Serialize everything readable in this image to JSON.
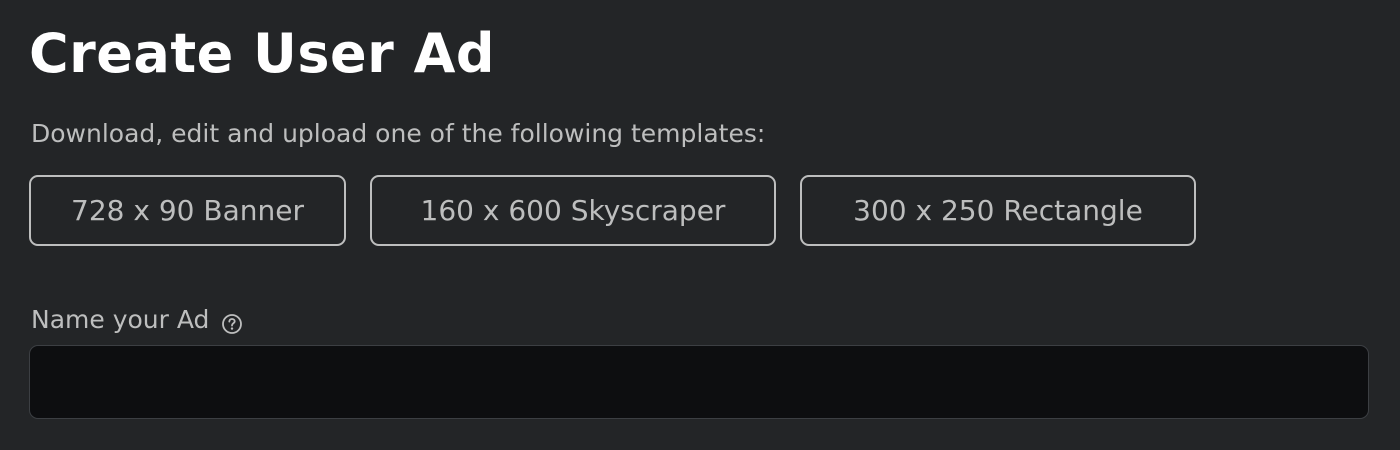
{
  "page": {
    "title": "Create User Ad",
    "instructions": "Download, edit and upload one of the following templates:"
  },
  "templates": [
    {
      "label": "728 x 90 Banner"
    },
    {
      "label": "160 x 600 Skyscraper"
    },
    {
      "label": "300 x 250 Rectangle"
    }
  ],
  "name_field": {
    "label": "Name your Ad",
    "help_icon": "question-circle-icon",
    "value": "",
    "placeholder": ""
  },
  "colors": {
    "background": "#232527",
    "title_text": "#ffffff",
    "body_text": "#bdbebe",
    "input_background": "#0d0e10",
    "input_border": "#3c3f43"
  }
}
